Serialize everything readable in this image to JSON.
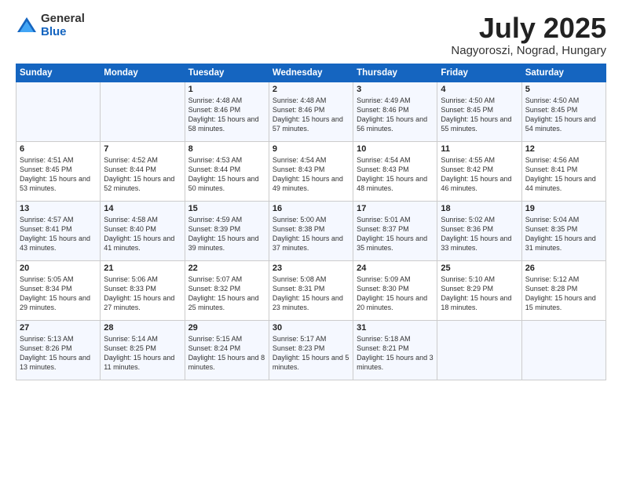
{
  "logo": {
    "general": "General",
    "blue": "Blue"
  },
  "title": "July 2025",
  "subtitle": "Nagyoroszi, Nograd, Hungary",
  "days_of_week": [
    "Sunday",
    "Monday",
    "Tuesday",
    "Wednesday",
    "Thursday",
    "Friday",
    "Saturday"
  ],
  "weeks": [
    [
      {
        "day": "",
        "info": ""
      },
      {
        "day": "",
        "info": ""
      },
      {
        "day": "1",
        "info": "Sunrise: 4:48 AM\nSunset: 8:46 PM\nDaylight: 15 hours and 58 minutes."
      },
      {
        "day": "2",
        "info": "Sunrise: 4:48 AM\nSunset: 8:46 PM\nDaylight: 15 hours and 57 minutes."
      },
      {
        "day": "3",
        "info": "Sunrise: 4:49 AM\nSunset: 8:46 PM\nDaylight: 15 hours and 56 minutes."
      },
      {
        "day": "4",
        "info": "Sunrise: 4:50 AM\nSunset: 8:45 PM\nDaylight: 15 hours and 55 minutes."
      },
      {
        "day": "5",
        "info": "Sunrise: 4:50 AM\nSunset: 8:45 PM\nDaylight: 15 hours and 54 minutes."
      }
    ],
    [
      {
        "day": "6",
        "info": "Sunrise: 4:51 AM\nSunset: 8:45 PM\nDaylight: 15 hours and 53 minutes."
      },
      {
        "day": "7",
        "info": "Sunrise: 4:52 AM\nSunset: 8:44 PM\nDaylight: 15 hours and 52 minutes."
      },
      {
        "day": "8",
        "info": "Sunrise: 4:53 AM\nSunset: 8:44 PM\nDaylight: 15 hours and 50 minutes."
      },
      {
        "day": "9",
        "info": "Sunrise: 4:54 AM\nSunset: 8:43 PM\nDaylight: 15 hours and 49 minutes."
      },
      {
        "day": "10",
        "info": "Sunrise: 4:54 AM\nSunset: 8:43 PM\nDaylight: 15 hours and 48 minutes."
      },
      {
        "day": "11",
        "info": "Sunrise: 4:55 AM\nSunset: 8:42 PM\nDaylight: 15 hours and 46 minutes."
      },
      {
        "day": "12",
        "info": "Sunrise: 4:56 AM\nSunset: 8:41 PM\nDaylight: 15 hours and 44 minutes."
      }
    ],
    [
      {
        "day": "13",
        "info": "Sunrise: 4:57 AM\nSunset: 8:41 PM\nDaylight: 15 hours and 43 minutes."
      },
      {
        "day": "14",
        "info": "Sunrise: 4:58 AM\nSunset: 8:40 PM\nDaylight: 15 hours and 41 minutes."
      },
      {
        "day": "15",
        "info": "Sunrise: 4:59 AM\nSunset: 8:39 PM\nDaylight: 15 hours and 39 minutes."
      },
      {
        "day": "16",
        "info": "Sunrise: 5:00 AM\nSunset: 8:38 PM\nDaylight: 15 hours and 37 minutes."
      },
      {
        "day": "17",
        "info": "Sunrise: 5:01 AM\nSunset: 8:37 PM\nDaylight: 15 hours and 35 minutes."
      },
      {
        "day": "18",
        "info": "Sunrise: 5:02 AM\nSunset: 8:36 PM\nDaylight: 15 hours and 33 minutes."
      },
      {
        "day": "19",
        "info": "Sunrise: 5:04 AM\nSunset: 8:35 PM\nDaylight: 15 hours and 31 minutes."
      }
    ],
    [
      {
        "day": "20",
        "info": "Sunrise: 5:05 AM\nSunset: 8:34 PM\nDaylight: 15 hours and 29 minutes."
      },
      {
        "day": "21",
        "info": "Sunrise: 5:06 AM\nSunset: 8:33 PM\nDaylight: 15 hours and 27 minutes."
      },
      {
        "day": "22",
        "info": "Sunrise: 5:07 AM\nSunset: 8:32 PM\nDaylight: 15 hours and 25 minutes."
      },
      {
        "day": "23",
        "info": "Sunrise: 5:08 AM\nSunset: 8:31 PM\nDaylight: 15 hours and 23 minutes."
      },
      {
        "day": "24",
        "info": "Sunrise: 5:09 AM\nSunset: 8:30 PM\nDaylight: 15 hours and 20 minutes."
      },
      {
        "day": "25",
        "info": "Sunrise: 5:10 AM\nSunset: 8:29 PM\nDaylight: 15 hours and 18 minutes."
      },
      {
        "day": "26",
        "info": "Sunrise: 5:12 AM\nSunset: 8:28 PM\nDaylight: 15 hours and 15 minutes."
      }
    ],
    [
      {
        "day": "27",
        "info": "Sunrise: 5:13 AM\nSunset: 8:26 PM\nDaylight: 15 hours and 13 minutes."
      },
      {
        "day": "28",
        "info": "Sunrise: 5:14 AM\nSunset: 8:25 PM\nDaylight: 15 hours and 11 minutes."
      },
      {
        "day": "29",
        "info": "Sunrise: 5:15 AM\nSunset: 8:24 PM\nDaylight: 15 hours and 8 minutes."
      },
      {
        "day": "30",
        "info": "Sunrise: 5:17 AM\nSunset: 8:23 PM\nDaylight: 15 hours and 5 minutes."
      },
      {
        "day": "31",
        "info": "Sunrise: 5:18 AM\nSunset: 8:21 PM\nDaylight: 15 hours and 3 minutes."
      },
      {
        "day": "",
        "info": ""
      },
      {
        "day": "",
        "info": ""
      }
    ]
  ]
}
